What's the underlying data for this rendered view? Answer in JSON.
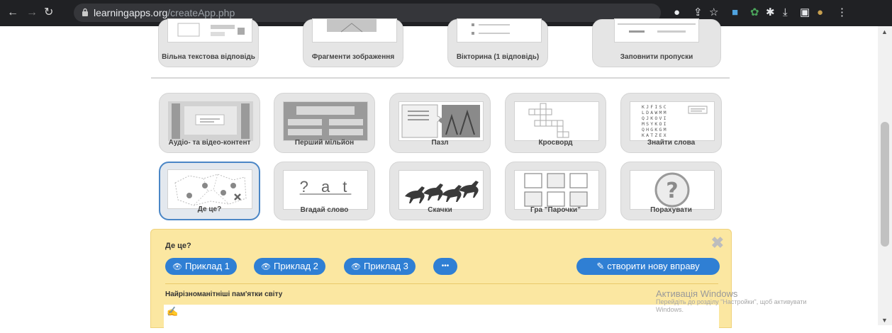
{
  "browser": {
    "url_domain": "learningapps.org",
    "url_path": "/createApp.php"
  },
  "top_row": [
    {
      "label": "Вільна текстова відповідь"
    },
    {
      "label": "Фрагменти зображення"
    },
    {
      "label": "Вікторина (1 відповідь)"
    },
    {
      "label": "Заповнити пропуски"
    }
  ],
  "row2": [
    {
      "label": "Аудіо- та відео-контент"
    },
    {
      "label": "Перший мільйон"
    },
    {
      "label": "Пазл"
    },
    {
      "label": "Кросворд"
    },
    {
      "label": "Знайти слова"
    }
  ],
  "row3": [
    {
      "label": "Де це?"
    },
    {
      "label": "Вгадай слово"
    },
    {
      "label": "Скачки"
    },
    {
      "label": "Гра \"Парочки\""
    },
    {
      "label": "Порахувати"
    }
  ],
  "guess_word_thumb": {
    "letters": "? a t"
  },
  "word_grid": [
    "KJFISC",
    "LDAWMM",
    "QJKOVI",
    "MSYKOI",
    "QHGKGM",
    "KATZEX"
  ],
  "panel": {
    "title": "Де це?",
    "example1": "Приклад 1",
    "example2": "Приклад 2",
    "example3": "Приклад 3",
    "more": "•••",
    "create": "створити нову вправу",
    "subtitle": "Найрізноманітніші пам'ятки світу"
  },
  "watermark": {
    "line1": "Активація Windows",
    "line2": "Перейдіть до розділу \"Настройки\", щоб активувати",
    "line3": "Windows."
  }
}
